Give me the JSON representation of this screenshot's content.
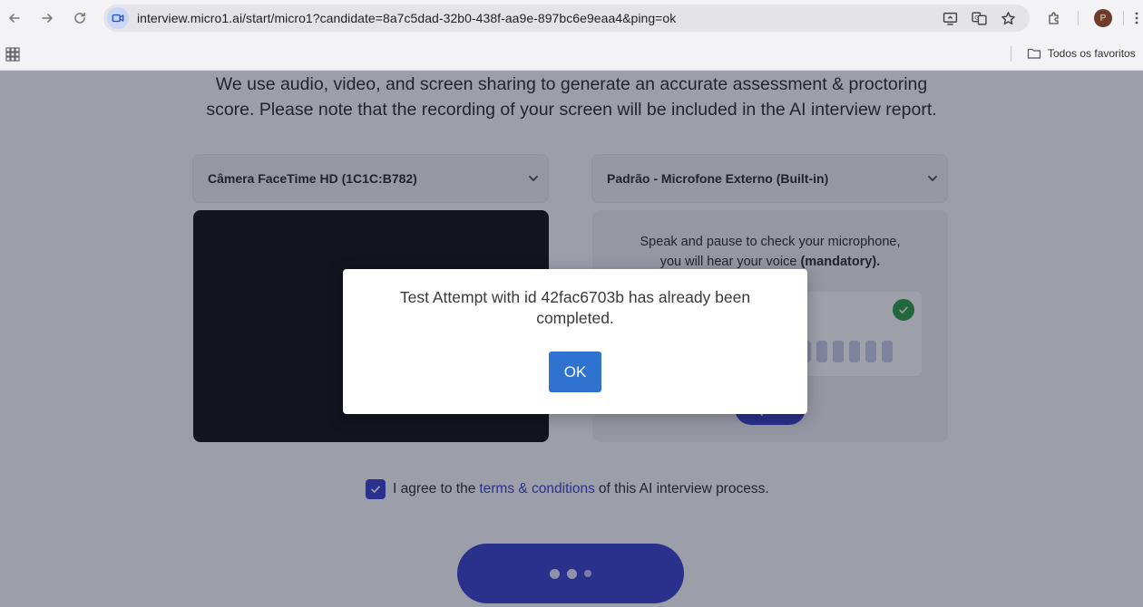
{
  "browser": {
    "url": "interview.micro1.ai/start/micro1?candidate=8a7c5dad-32b0-438f-aa9e-897bc6e9eaa4&ping=ok",
    "profile_initial": "P",
    "bookmarks_folder_label": "Todos os favoritos",
    "icons": [
      "back-arrow-icon",
      "forward-arrow-icon",
      "reload-icon",
      "site-video-icon",
      "cast-icon",
      "translate-icon",
      "star-icon",
      "extensions-icon",
      "more-vert-icon",
      "apps-grid-icon",
      "folder-icon"
    ]
  },
  "page": {
    "intro_line1": "We use audio, video, and screen sharing to generate an accurate assessment & proctoring",
    "intro_line2": "score. Please note that the recording of your screen will be included in the AI interview report.",
    "camera_select_value": "Câmera FaceTime HD (1C1C:B782)",
    "mic_select_value": "Padrão - Microfone Externo (Built-in)",
    "mic_instruction_line1": "Speak and pause to check your microphone,",
    "mic_instruction_line2": "you will hear your voice",
    "mic_instruction_emphasis": "(mandatory).",
    "speak_button_label": "Speak",
    "agree_prefix": "I agree to the",
    "agree_link": "terms & conditions",
    "agree_suffix": "of this AI interview process.",
    "agree_checked": true
  },
  "modal": {
    "message": "Test Attempt with id 42fac6703b has already been completed.",
    "ok_label": "OK"
  },
  "colors": {
    "accent": "#2d35c8",
    "ok_button": "#2f72d0",
    "success": "#1f9a3a"
  }
}
